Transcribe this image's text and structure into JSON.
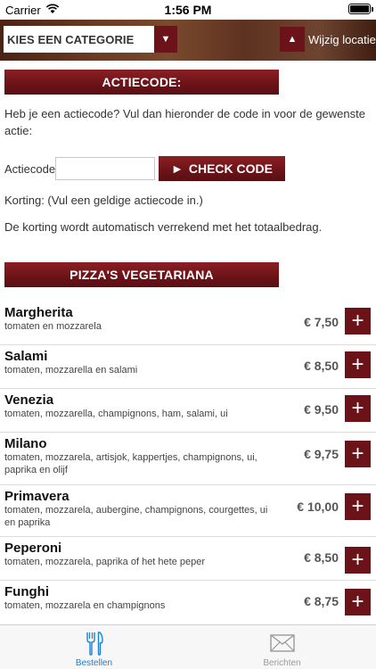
{
  "status_bar": {
    "carrier": "Carrier",
    "time": "1:56 PM"
  },
  "header": {
    "category_select": "KIES EEN CATEGORIE",
    "location_label": "Wijzig locatie"
  },
  "promo": {
    "title": "ACTIECODE:",
    "intro": "Heb je een actiecode? Vul dan hieronder de code in voor de gewenste actie:",
    "field_label": "Actiecode",
    "field_value": "",
    "button_label": "CHECK CODE",
    "discount_text": "Korting: (Vul een geldige actiecode in.)",
    "note": "De korting wordt automatisch verrekend met het totaalbedrag."
  },
  "section": {
    "title": "PIZZA'S VEGETARIANA"
  },
  "menu": [
    {
      "name": "Margherita",
      "desc": "tomaten en mozzarela",
      "price": "€ 7,50"
    },
    {
      "name": "Salami",
      "desc": "tomaten, mozzarella en salami",
      "price": "€ 8,50"
    },
    {
      "name": "Venezia",
      "desc": "tomaten, mozzarella, champignons, ham, salami, ui",
      "price": "€ 9,50"
    },
    {
      "name": "Milano",
      "desc": "tomaten, mozzarela, artisjok, kappertjes, champignons, ui, paprika en olijf",
      "price": "€ 9,75"
    },
    {
      "name": "Primavera",
      "desc": "tomaten, mozzarela, aubergine, champignons, courgettes, ui en paprika",
      "price": "€ 10,00"
    },
    {
      "name": "Peperoni",
      "desc": "tomaten, mozzarela, paprika of het hete peper",
      "price": "€ 8,50"
    },
    {
      "name": "Funghi",
      "desc": "tomaten, mozzarela en champignons",
      "price": "€ 8,75"
    }
  ],
  "tabs": [
    {
      "label": "Bestellen",
      "icon": "fork-knife-icon",
      "active": true
    },
    {
      "label": "Berichten",
      "icon": "envelope-icon",
      "active": false
    }
  ],
  "colors": {
    "accent": "#6b1318",
    "tab_active": "#1a7fd6",
    "tab_inactive": "#9a9a9a"
  }
}
